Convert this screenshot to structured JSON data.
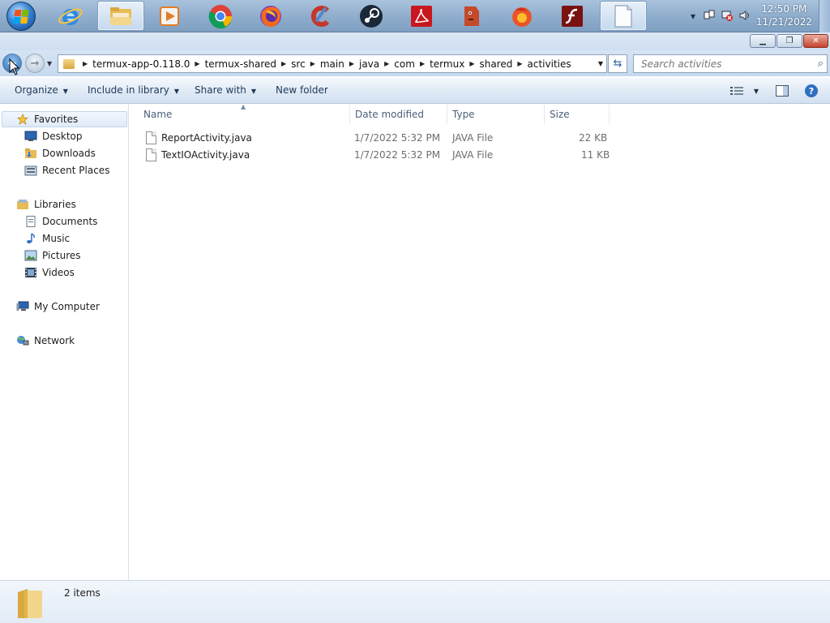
{
  "taskbar": {
    "apps": [
      {
        "name": "start-orb"
      },
      {
        "name": "internet-explorer-icon",
        "color": "#1a73c8"
      },
      {
        "name": "windows-explorer-icon",
        "color": "#e3b24a",
        "active": true
      },
      {
        "name": "media-player-icon",
        "color": "#e27d22"
      },
      {
        "name": "chrome-icon",
        "color": "#db4437"
      },
      {
        "name": "firefox-icon",
        "color": "#f36a1c"
      },
      {
        "name": "ccleaner-icon",
        "color": "#c4372b"
      },
      {
        "name": "steam-icon",
        "color": "#1b2838"
      },
      {
        "name": "acrobat-reader-icon",
        "color": "#c8171e"
      },
      {
        "name": "ghost-app-icon",
        "color": "#c44a2a"
      },
      {
        "name": "firefox-dev-icon",
        "color": "#e9552a"
      },
      {
        "name": "flash-player-icon",
        "color": "#7a1212"
      },
      {
        "name": "blank-document-icon",
        "color": "#ffffff",
        "active": true
      }
    ],
    "clock_time": "12:50 PM",
    "clock_date": "11/21/2022"
  },
  "address_bar": {
    "crumbs": [
      "termux-app-0.118.0",
      "termux-shared",
      "src",
      "main",
      "java",
      "com",
      "termux",
      "shared",
      "activities"
    ]
  },
  "search": {
    "placeholder": "Search activities"
  },
  "commands": {
    "organize": "Organize",
    "include_in_library": "Include in library",
    "share_with": "Share with",
    "new_folder": "New folder"
  },
  "nav_pane": {
    "favorites": "Favorites",
    "desktop": "Desktop",
    "downloads": "Downloads",
    "recent_places": "Recent Places",
    "libraries": "Libraries",
    "documents": "Documents",
    "music": "Music",
    "pictures": "Pictures",
    "videos": "Videos",
    "computer": "My Computer",
    "network": "Network"
  },
  "columns": {
    "name": "Name",
    "date_modified": "Date modified",
    "type": "Type",
    "size": "Size"
  },
  "files": [
    {
      "name": "ReportActivity.java",
      "date": "1/7/2022 5:32 PM",
      "type": "JAVA File",
      "size": "22 KB"
    },
    {
      "name": "TextIOActivity.java",
      "date": "1/7/2022 5:32 PM",
      "type": "JAVA File",
      "size": "11 KB"
    }
  ],
  "status": {
    "items_count": "2 items"
  },
  "colors": {
    "accent": "#1e395b",
    "selection": "#dfeaf7",
    "taskbar": "#90aecd"
  }
}
